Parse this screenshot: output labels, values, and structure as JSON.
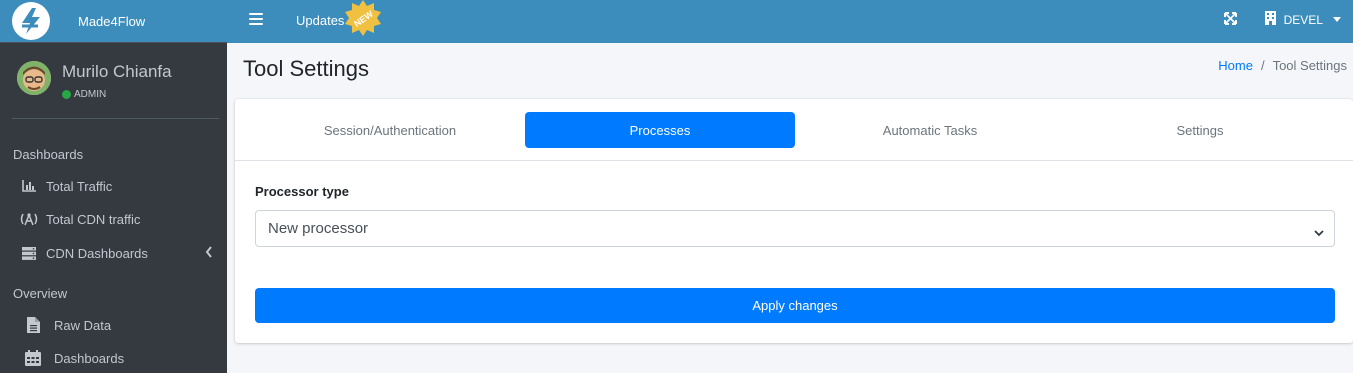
{
  "brand": {
    "name": "Made4Flow",
    "logo_icon": "made4flow-logo-icon"
  },
  "user": {
    "name": "Murilo Chianfa",
    "role": "ADMIN",
    "status_color": "#28a745"
  },
  "sidebar": {
    "sections": [
      {
        "header": "Dashboards",
        "items": [
          {
            "label": "Total Traffic",
            "icon": "bar-chart-icon"
          },
          {
            "label": "Total CDN traffic",
            "icon": "broadcast-tower-icon"
          },
          {
            "label": "CDN Dashboards",
            "icon": "server-icon",
            "has_submenu": true
          }
        ]
      },
      {
        "header": "Overview",
        "items": [
          {
            "label": "Raw Data",
            "icon": "file-icon"
          },
          {
            "label": "Dashboards",
            "icon": "calendar-icon"
          }
        ]
      }
    ]
  },
  "topbar": {
    "updates_label": "Updates",
    "new_badge": "NEW",
    "environment": "DEVEL"
  },
  "page": {
    "title": "Tool Settings",
    "breadcrumb": {
      "home": "Home",
      "separator": "/",
      "current": "Tool Settings"
    }
  },
  "tabs": [
    {
      "label": "Session/Authentication",
      "active": false
    },
    {
      "label": "Processes",
      "active": true
    },
    {
      "label": "Automatic Tasks",
      "active": false
    },
    {
      "label": "Settings",
      "active": false
    }
  ],
  "form": {
    "processor_type_label": "Processor type",
    "processor_type_value": "New processor",
    "apply_button": "Apply changes"
  },
  "colors": {
    "primary": "#007bff",
    "header": "#3c8dbc",
    "sidebar": "#343a40",
    "badge": "#f0c040"
  }
}
